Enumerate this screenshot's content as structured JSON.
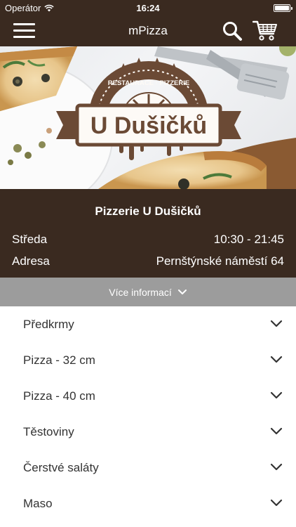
{
  "status_bar": {
    "carrier": "Operátor",
    "time": "16:24"
  },
  "nav": {
    "title": "mPizza"
  },
  "hero": {
    "logo_top_text": "RESTAURACE · PIZZERIE",
    "logo_name": "U Dušičků"
  },
  "info": {
    "name": "Pizzerie U Dušičků",
    "day_label": "Středa",
    "hours": "10:30 - 21:45",
    "address_label": "Adresa",
    "address": "Pernštýnské náměstí 64"
  },
  "more_info": {
    "label": "Více informací"
  },
  "categories": [
    {
      "label": "Předkrmy"
    },
    {
      "label": "Pizza - 32 cm"
    },
    {
      "label": "Pizza - 40 cm"
    },
    {
      "label": "Těstoviny"
    },
    {
      "label": "Čerstvé saláty"
    },
    {
      "label": "Maso"
    }
  ],
  "colors": {
    "brand_dark": "#3a2a20",
    "more_bar": "#9c9c9c",
    "logo_brown": "#6b4a35"
  }
}
